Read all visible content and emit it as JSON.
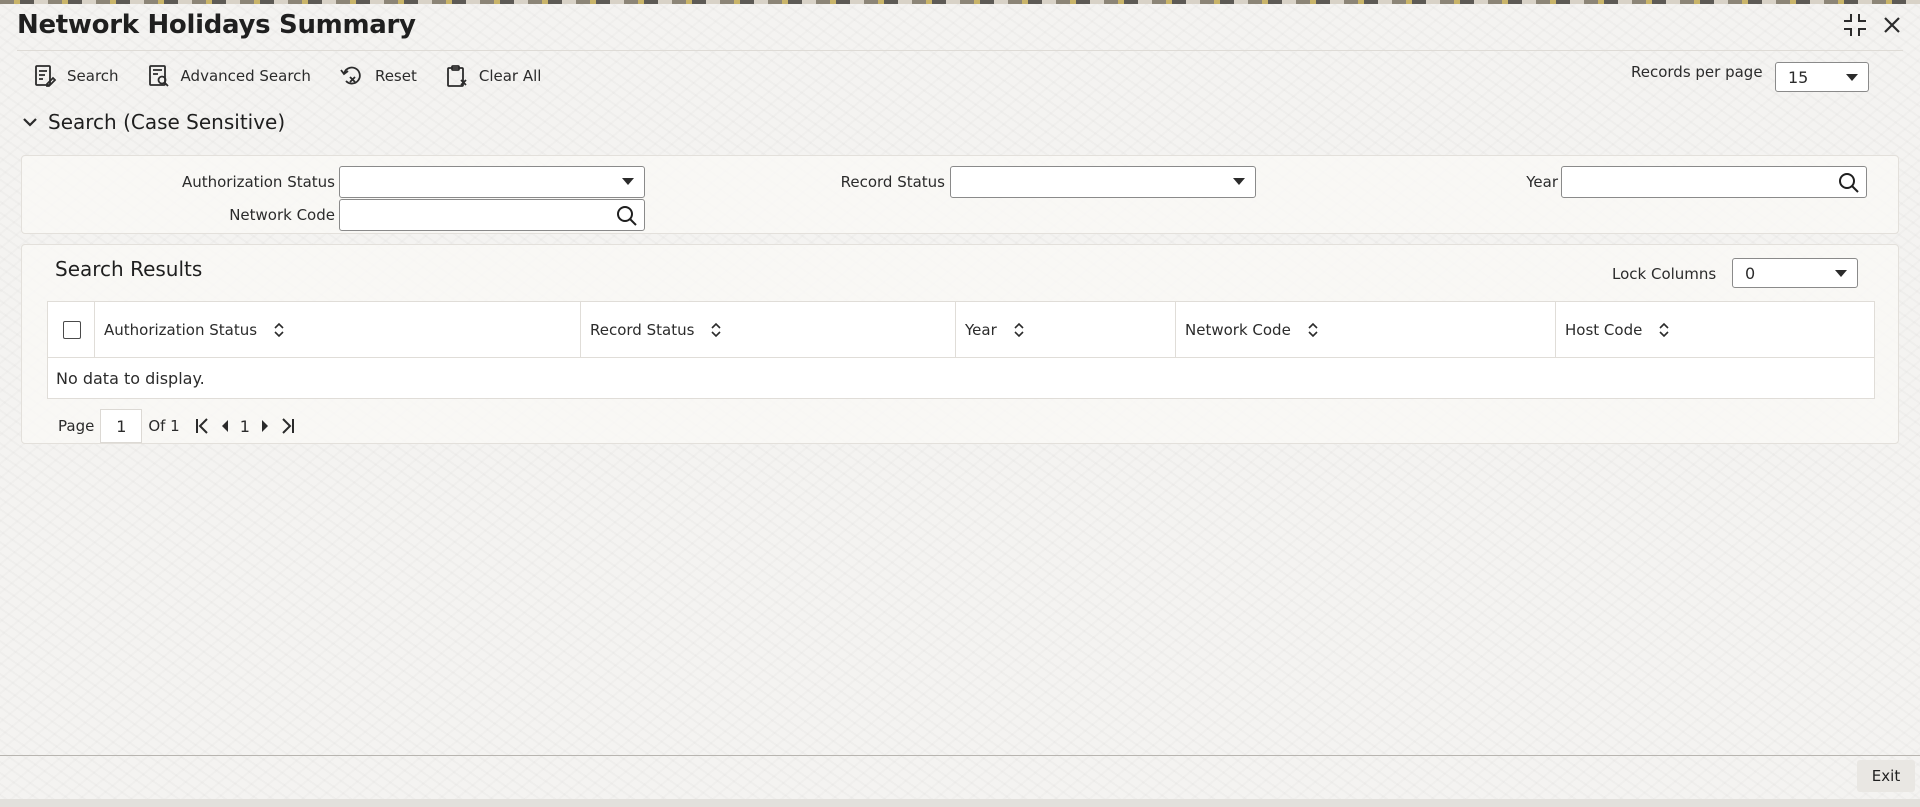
{
  "window": {
    "title": "Network Holidays Summary"
  },
  "toolbar": {
    "search_label": "Search",
    "advanced_search_label": "Advanced Search",
    "reset_label": "Reset",
    "clear_all_label": "Clear All"
  },
  "records_per_page": {
    "label": "Records per page",
    "value": "15"
  },
  "search_section": {
    "title": "Search (Case Sensitive)",
    "fields": {
      "authorization_status_label": "Authorization Status",
      "authorization_status_value": "",
      "record_status_label": "Record Status",
      "record_status_value": "",
      "year_label": "Year",
      "year_value": "",
      "network_code_label": "Network Code",
      "network_code_value": ""
    }
  },
  "results": {
    "title": "Search Results",
    "lock_columns_label": "Lock Columns",
    "lock_columns_value": "0",
    "columns": [
      "Authorization Status",
      "Record Status",
      "Year",
      "Network Code",
      "Host Code"
    ],
    "empty_message": "No data to display."
  },
  "pager": {
    "page_label": "Page",
    "current_page": "1",
    "of_label": "Of 1",
    "nav_page": "1"
  },
  "footer": {
    "exit_label": "Exit"
  },
  "icons": {
    "expand": "expand-icon",
    "close": "close-icon",
    "search": "search-document-icon",
    "advanced_search": "advanced-search-icon",
    "reset": "reset-icon",
    "clear_all": "clear-all-icon",
    "chevron": "chevron-down-icon",
    "lens": "magnifier-icon",
    "sort": "sort-icon"
  }
}
